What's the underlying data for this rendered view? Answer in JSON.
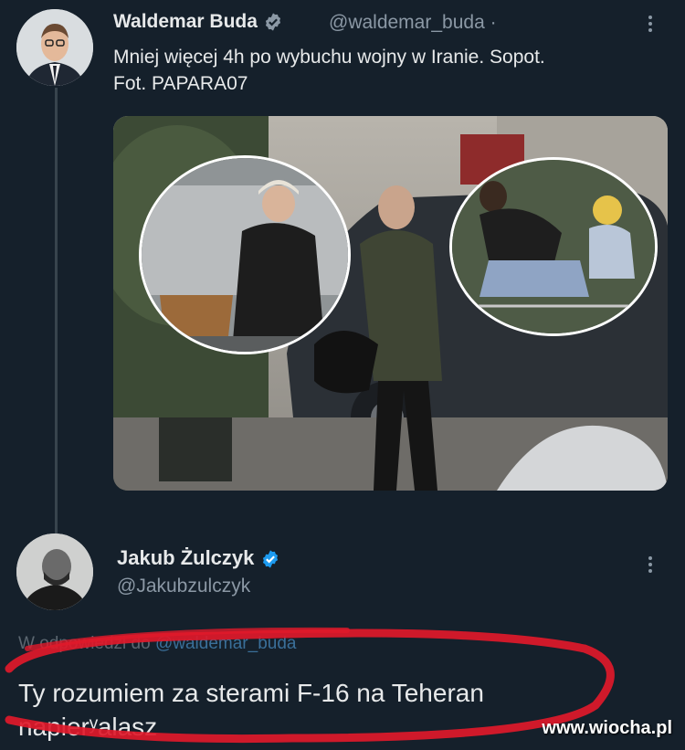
{
  "tweet": {
    "author_name": "Waldemar Buda",
    "author_handle": "@waldemar_buda",
    "dot": "·",
    "text_line1": "Mniej więcej 4h po wybuchu wojny w Iranie. Sopot.",
    "text_line2": "Fot. PAPARA07"
  },
  "reply": {
    "author_name": "Jakub Żulczyk",
    "author_handle": "@Jakubzulczyk",
    "in_reply_prefix": "W odpowiedzi do",
    "in_reply_mention": "@waldemar_buda",
    "text_line1": "Ty rozumiem za sterami F-16 na Teheran",
    "text_line2": "napierʸalasz"
  },
  "watermark": "www.wiocha.pl",
  "colors": {
    "background": "#15202b",
    "verified": "#1d9bf0",
    "annotation_red": "#e0192a"
  },
  "icons": [
    "verified-badge-icon",
    "more-options-icon"
  ]
}
